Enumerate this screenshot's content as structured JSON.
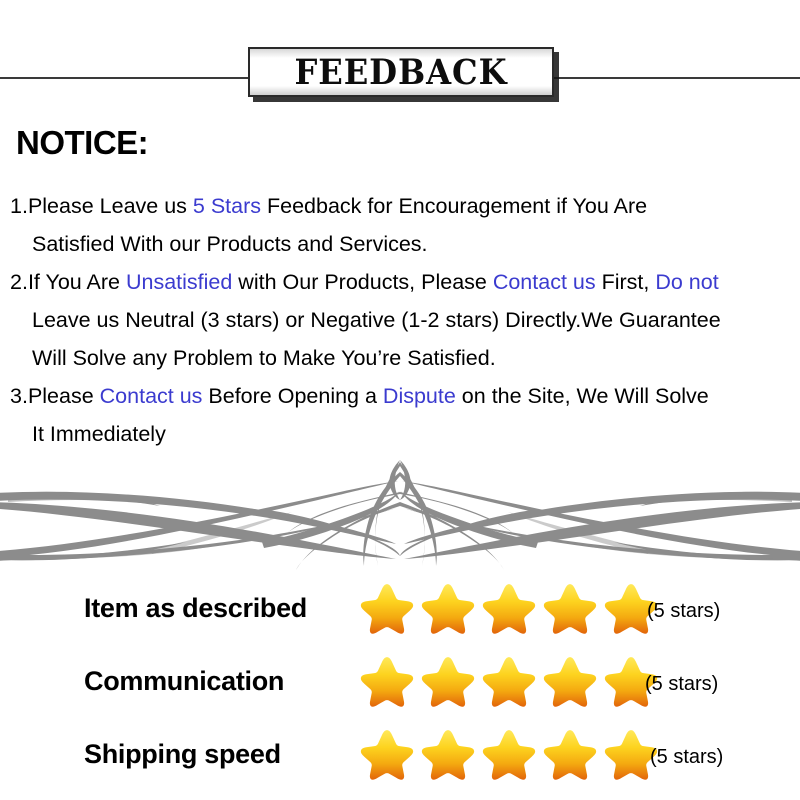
{
  "header": {
    "banner_title": "FEEDBACK"
  },
  "notice": {
    "heading": "NOTICE:",
    "items": [
      {
        "number": "1.",
        "lines": [
          [
            {
              "text": "Please Leave us  ",
              "style": "plain"
            },
            {
              "text": "5 Stars",
              "style": "highlight"
            },
            {
              "text": "  Feedback for  Encouragement  if You Are",
              "style": "plain"
            }
          ],
          [
            {
              "text": "Satisfied With our Products and Services.",
              "style": "plain"
            }
          ]
        ]
      },
      {
        "number": "2.",
        "lines": [
          [
            {
              "text": "If You Are ",
              "style": "plain"
            },
            {
              "text": "Unsatisfied",
              "style": "highlight"
            },
            {
              "text": " with Our Products, Please ",
              "style": "plain"
            },
            {
              "text": "Contact us",
              "style": "highlight"
            },
            {
              "text": " First, ",
              "style": "plain"
            },
            {
              "text": "Do not",
              "style": "highlight"
            }
          ],
          [
            {
              "text": "Leave us Neutral (3 stars) or Negative (1-2 stars) Directly.We Guarantee",
              "style": "plain"
            }
          ],
          [
            {
              "text": "Will Solve any Problem to Make You’re  Satisfied.",
              "style": "plain"
            }
          ]
        ]
      },
      {
        "number": "3.",
        "lines": [
          [
            {
              "text": "Please ",
              "style": "plain"
            },
            {
              "text": "Contact us",
              "style": "highlight"
            },
            {
              "text": " Before Opening a ",
              "style": "plain"
            },
            {
              "text": "Dispute",
              "style": "highlight"
            },
            {
              "text": " on the Site, We Will Solve",
              "style": "plain"
            }
          ],
          [
            {
              "text": "It Immediately",
              "style": "plain"
            }
          ]
        ]
      }
    ]
  },
  "ornament": {
    "icon": "filigree-flourish-divider",
    "color": "#8c8c8c"
  },
  "ratings": {
    "rows": [
      {
        "label": "Item as described",
        "star_count": 5,
        "count_label": "(5 stars)"
      },
      {
        "label": "Communication",
        "star_count": 5,
        "count_label": "(5 stars)"
      },
      {
        "label": "Shipping speed",
        "star_count": 5,
        "count_label": "(5 stars)"
      }
    ],
    "star_icon": "star-icon",
    "star_color_top": "#ffe13b",
    "star_color_mid": "#f5b21a",
    "star_color_bottom": "#e8740c"
  },
  "colors": {
    "highlight_blue": "#3b3bcf",
    "text_black": "#000000",
    "ornament_gray": "#8c8c8c",
    "background": "#ffffff"
  }
}
